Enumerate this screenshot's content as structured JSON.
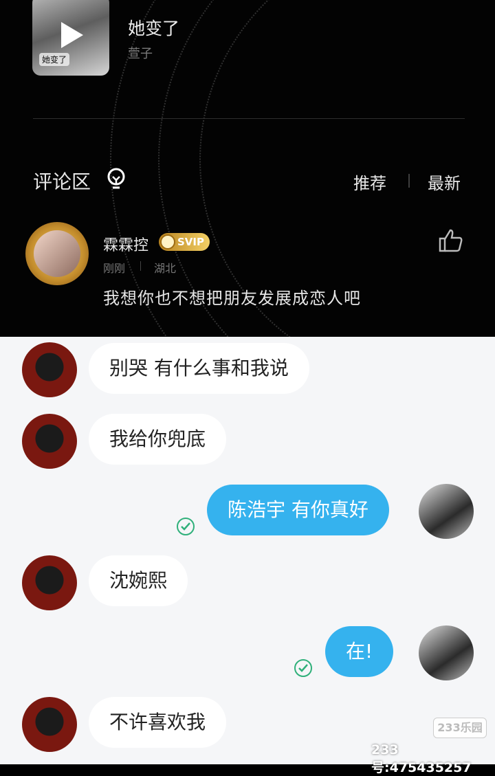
{
  "music_card": {
    "title": "她变了",
    "artist": "萱子",
    "cover_tag": "她变了"
  },
  "comments": {
    "section_title": "评论区",
    "sort_recommend": "推荐",
    "sort_latest": "最新",
    "top_comment": {
      "user_name": "霖霖控",
      "badge": "SVIP",
      "time": "刚刚",
      "location": "湖北",
      "text": "我想你也不想把朋友发展成恋人吧"
    }
  },
  "chat": {
    "messages": [
      {
        "side": "left",
        "text": "别哭 有什么事和我说"
      },
      {
        "side": "left",
        "text": "我给你兜底"
      },
      {
        "side": "right",
        "text": "陈浩宇 有你真好",
        "read": true
      },
      {
        "side": "left",
        "text": "沈婉熙"
      },
      {
        "side": "right",
        "text": "在!",
        "read": true
      },
      {
        "side": "left",
        "text": "不许喜欢我"
      }
    ]
  },
  "watermark": {
    "badge": "233乐园",
    "id_text": "233号:475435257"
  },
  "colors": {
    "outgoing_bubble": "#35b2ee",
    "incoming_bubble": "#ffffff",
    "read_check": "#2fb07a",
    "svip_gold": "#e0b245"
  }
}
